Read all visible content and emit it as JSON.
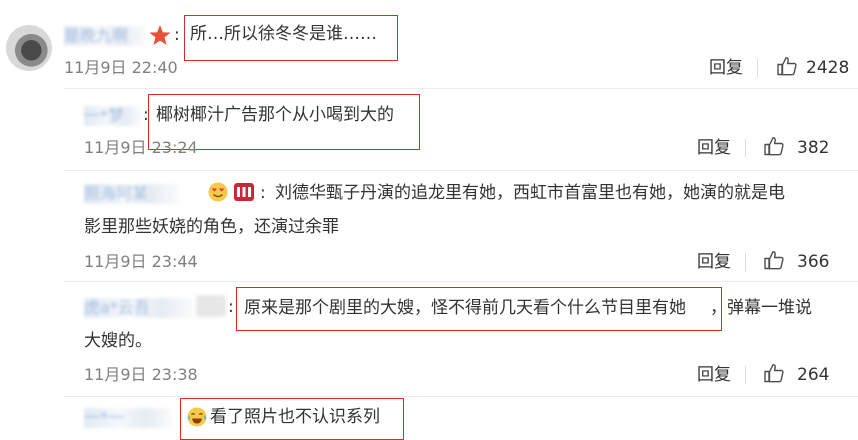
{
  "comments": [
    {
      "username": "是晚九啊",
      "content": "所…所以徐冬冬是谁……",
      "time": "11月9日 22:40",
      "reply": "回复",
      "likes": "2428"
    },
    {
      "username": "一*梦",
      "content": "椰树椰汁广告那个从小喝到大的",
      "time": "11月9日 23:24",
      "reply": "回复",
      "likes": "382"
    },
    {
      "username": "照海阿某",
      "content_line1": "刘德华甄子丹演的追龙里有她，西虹市首富里也有她，她演的就是电",
      "content_line2": "影里那些妖娆的角色，还演过余罪",
      "time": "11月9日 23:44",
      "reply": "回复",
      "likes": "366"
    },
    {
      "username": "虎a*云吾",
      "content_highlight": "原来是那个剧里的大嫂，怪不得前几天看个什么节目里有她",
      "content_rest": "，弹幕一堆说",
      "content_line2": "大嫂的。",
      "time": "11月9日 23:38",
      "reply": "回复",
      "likes": "264"
    },
    {
      "username": "一*一",
      "content": "看了照片也不认识系列"
    }
  ],
  "colors": {
    "highlight_border": "#d62b2b",
    "username": "#5b87c5",
    "time": "#808080",
    "text": "#333333"
  }
}
